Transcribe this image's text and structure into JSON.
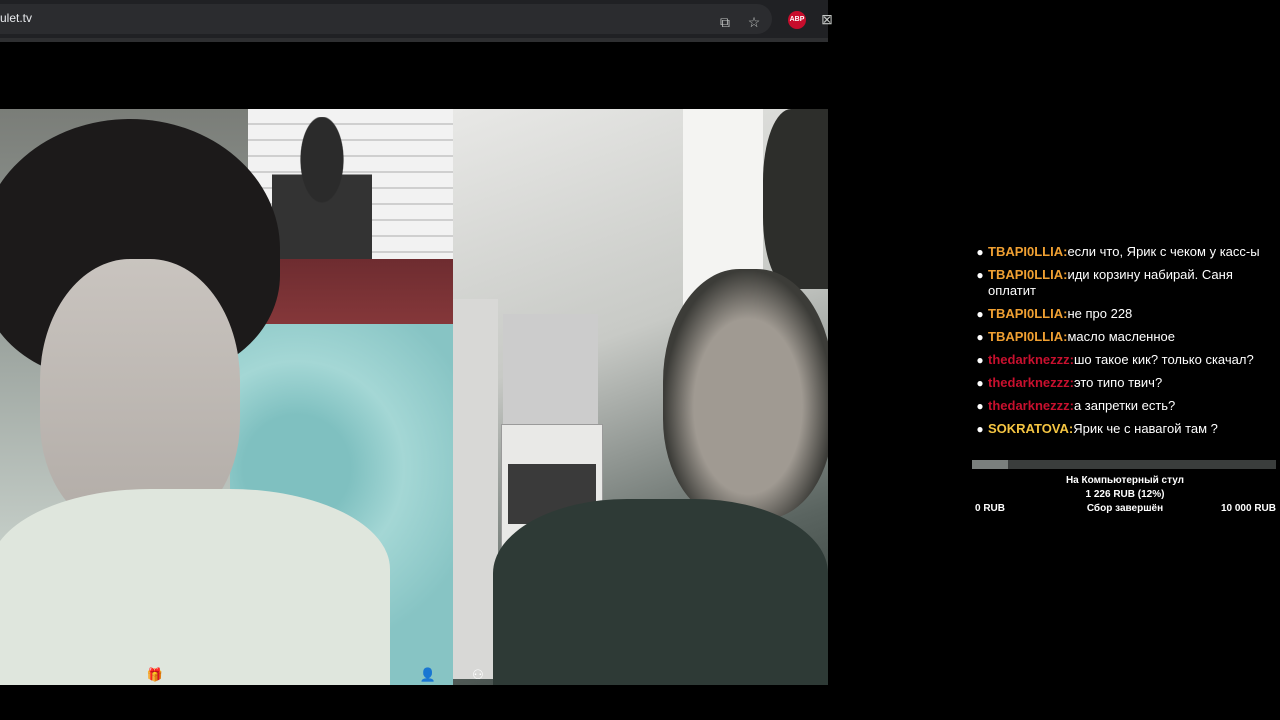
{
  "browser": {
    "url": "ulet.tv",
    "icons": [
      "cast-icon",
      "star-icon",
      "adblock-icon",
      "extension-icon"
    ],
    "adblock_label": "ABP"
  },
  "video": {
    "left_cam": {
      "control_icon": "gift-icon"
    },
    "right_cam": {
      "control_icon": "people-icon"
    },
    "center_control_icon": "person-icon"
  },
  "chat": {
    "messages": [
      {
        "nick": "TBAPI0LLIA:",
        "text": "если что, Ярик с чеком у касс-ы",
        "nick_color": "#f0a032"
      },
      {
        "nick": "TBAPI0LLIA:",
        "text": "иди корзину набирай. Саня оплатит",
        "nick_color": "#f0a032"
      },
      {
        "nick": "TBAPI0LLIA:",
        "text": "не про 228",
        "nick_color": "#f0a032"
      },
      {
        "nick": "TBAPI0LLIA:",
        "text": "масло масленное",
        "nick_color": "#f0a032"
      },
      {
        "nick": "thedarknezzz:",
        "text": "шо такое кик? только скачал?",
        "nick_color": "#c8102e"
      },
      {
        "nick": "thedarknezzz:",
        "text": "это типо твич?",
        "nick_color": "#c8102e"
      },
      {
        "nick": "thedarknezzz:",
        "text": "а запретки есть?",
        "nick_color": "#c8102e"
      },
      {
        "nick": "SOKRATOVA:",
        "text": "Ярик че с навагой там ?",
        "nick_color": "#f5c542"
      }
    ]
  },
  "goal": {
    "title": "На Компьютерный стул",
    "amount": "1 226 RUB (12%)",
    "min": "0 RUB",
    "status": "Сбор завершён",
    "max": "10 000 RUB",
    "progress": 0.12
  }
}
